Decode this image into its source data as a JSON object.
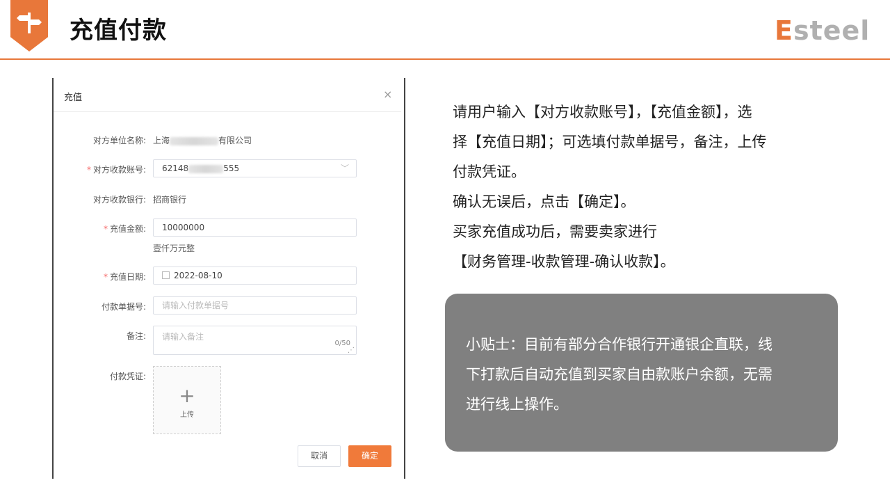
{
  "header": {
    "title": "充值付款",
    "logo_e": "E",
    "logo_rest": "steel",
    "accent_color": "#e8773a"
  },
  "dialog": {
    "title": "充值",
    "close_icon": "×",
    "fields": {
      "company": {
        "label": "对方单位名称:",
        "value_prefix": "上海",
        "value_suffix": "有限公司"
      },
      "account": {
        "label": "对方收款账号:",
        "value_prefix": "62148",
        "value_suffix": "555",
        "required": "*"
      },
      "bank": {
        "label": "对方收款银行:",
        "value": "招商银行"
      },
      "amount": {
        "label": "充值金额:",
        "value": "10000000",
        "uppercase": "壹仟万元整",
        "required": "*"
      },
      "date": {
        "label": "充值日期:",
        "value": "2022-08-10",
        "required": "*"
      },
      "payment_no": {
        "label": "付款单据号:",
        "placeholder": "请输入付款单据号"
      },
      "remark": {
        "label": "备注:",
        "placeholder": "请输入备注",
        "counter": "0/50"
      },
      "voucher": {
        "label": "付款凭证:",
        "upload_plus": "+",
        "upload_text": "上传"
      }
    },
    "buttons": {
      "cancel": "取消",
      "confirm": "确定"
    },
    "confirm_color": "#f07a3a"
  },
  "explanation": {
    "lines": [
      "请用户输入【对方收款账号】，【充值金额】，选",
      "择【充值日期】；可选填付款单据号，备注，上传",
      "付款凭证。",
      "确认无误后，点击【确定】。",
      "买家充值成功后，需要卖家进行",
      "【财务管理-收款管理-确认收款】。"
    ]
  },
  "tip": {
    "lines": [
      "小贴士：目前有部分合作银行开通银企直联，线",
      "下打款后自动充值到买家自由款账户余额，无需",
      "进行线上操作。"
    ],
    "box_color": "#808080"
  }
}
